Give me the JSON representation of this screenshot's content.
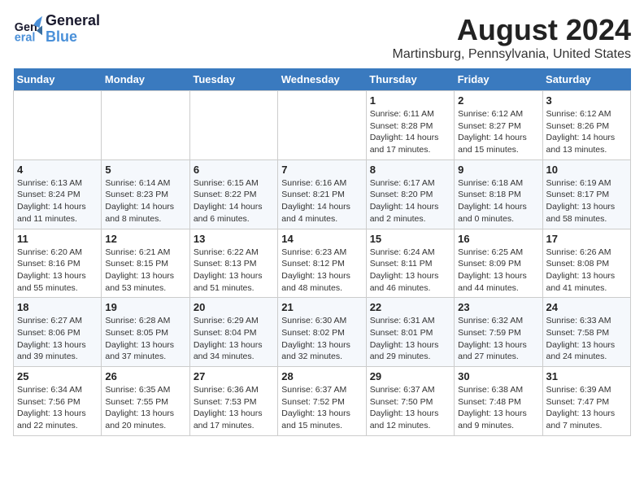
{
  "logo": {
    "text_general": "General",
    "text_blue": "Blue"
  },
  "title": {
    "month_year": "August 2024",
    "location": "Martinsburg, Pennsylvania, United States"
  },
  "headers": [
    "Sunday",
    "Monday",
    "Tuesday",
    "Wednesday",
    "Thursday",
    "Friday",
    "Saturday"
  ],
  "weeks": [
    [
      {
        "day": "",
        "info": ""
      },
      {
        "day": "",
        "info": ""
      },
      {
        "day": "",
        "info": ""
      },
      {
        "day": "",
        "info": ""
      },
      {
        "day": "1",
        "info": "Sunrise: 6:11 AM\nSunset: 8:28 PM\nDaylight: 14 hours\nand 17 minutes."
      },
      {
        "day": "2",
        "info": "Sunrise: 6:12 AM\nSunset: 8:27 PM\nDaylight: 14 hours\nand 15 minutes."
      },
      {
        "day": "3",
        "info": "Sunrise: 6:12 AM\nSunset: 8:26 PM\nDaylight: 14 hours\nand 13 minutes."
      }
    ],
    [
      {
        "day": "4",
        "info": "Sunrise: 6:13 AM\nSunset: 8:24 PM\nDaylight: 14 hours\nand 11 minutes."
      },
      {
        "day": "5",
        "info": "Sunrise: 6:14 AM\nSunset: 8:23 PM\nDaylight: 14 hours\nand 8 minutes."
      },
      {
        "day": "6",
        "info": "Sunrise: 6:15 AM\nSunset: 8:22 PM\nDaylight: 14 hours\nand 6 minutes."
      },
      {
        "day": "7",
        "info": "Sunrise: 6:16 AM\nSunset: 8:21 PM\nDaylight: 14 hours\nand 4 minutes."
      },
      {
        "day": "8",
        "info": "Sunrise: 6:17 AM\nSunset: 8:20 PM\nDaylight: 14 hours\nand 2 minutes."
      },
      {
        "day": "9",
        "info": "Sunrise: 6:18 AM\nSunset: 8:18 PM\nDaylight: 14 hours\nand 0 minutes."
      },
      {
        "day": "10",
        "info": "Sunrise: 6:19 AM\nSunset: 8:17 PM\nDaylight: 13 hours\nand 58 minutes."
      }
    ],
    [
      {
        "day": "11",
        "info": "Sunrise: 6:20 AM\nSunset: 8:16 PM\nDaylight: 13 hours\nand 55 minutes."
      },
      {
        "day": "12",
        "info": "Sunrise: 6:21 AM\nSunset: 8:15 PM\nDaylight: 13 hours\nand 53 minutes."
      },
      {
        "day": "13",
        "info": "Sunrise: 6:22 AM\nSunset: 8:13 PM\nDaylight: 13 hours\nand 51 minutes."
      },
      {
        "day": "14",
        "info": "Sunrise: 6:23 AM\nSunset: 8:12 PM\nDaylight: 13 hours\nand 48 minutes."
      },
      {
        "day": "15",
        "info": "Sunrise: 6:24 AM\nSunset: 8:11 PM\nDaylight: 13 hours\nand 46 minutes."
      },
      {
        "day": "16",
        "info": "Sunrise: 6:25 AM\nSunset: 8:09 PM\nDaylight: 13 hours\nand 44 minutes."
      },
      {
        "day": "17",
        "info": "Sunrise: 6:26 AM\nSunset: 8:08 PM\nDaylight: 13 hours\nand 41 minutes."
      }
    ],
    [
      {
        "day": "18",
        "info": "Sunrise: 6:27 AM\nSunset: 8:06 PM\nDaylight: 13 hours\nand 39 minutes."
      },
      {
        "day": "19",
        "info": "Sunrise: 6:28 AM\nSunset: 8:05 PM\nDaylight: 13 hours\nand 37 minutes."
      },
      {
        "day": "20",
        "info": "Sunrise: 6:29 AM\nSunset: 8:04 PM\nDaylight: 13 hours\nand 34 minutes."
      },
      {
        "day": "21",
        "info": "Sunrise: 6:30 AM\nSunset: 8:02 PM\nDaylight: 13 hours\nand 32 minutes."
      },
      {
        "day": "22",
        "info": "Sunrise: 6:31 AM\nSunset: 8:01 PM\nDaylight: 13 hours\nand 29 minutes."
      },
      {
        "day": "23",
        "info": "Sunrise: 6:32 AM\nSunset: 7:59 PM\nDaylight: 13 hours\nand 27 minutes."
      },
      {
        "day": "24",
        "info": "Sunrise: 6:33 AM\nSunset: 7:58 PM\nDaylight: 13 hours\nand 24 minutes."
      }
    ],
    [
      {
        "day": "25",
        "info": "Sunrise: 6:34 AM\nSunset: 7:56 PM\nDaylight: 13 hours\nand 22 minutes."
      },
      {
        "day": "26",
        "info": "Sunrise: 6:35 AM\nSunset: 7:55 PM\nDaylight: 13 hours\nand 20 minutes."
      },
      {
        "day": "27",
        "info": "Sunrise: 6:36 AM\nSunset: 7:53 PM\nDaylight: 13 hours\nand 17 minutes."
      },
      {
        "day": "28",
        "info": "Sunrise: 6:37 AM\nSunset: 7:52 PM\nDaylight: 13 hours\nand 15 minutes."
      },
      {
        "day": "29",
        "info": "Sunrise: 6:37 AM\nSunset: 7:50 PM\nDaylight: 13 hours\nand 12 minutes."
      },
      {
        "day": "30",
        "info": "Sunrise: 6:38 AM\nSunset: 7:48 PM\nDaylight: 13 hours\nand 9 minutes."
      },
      {
        "day": "31",
        "info": "Sunrise: 6:39 AM\nSunset: 7:47 PM\nDaylight: 13 hours\nand 7 minutes."
      }
    ]
  ]
}
